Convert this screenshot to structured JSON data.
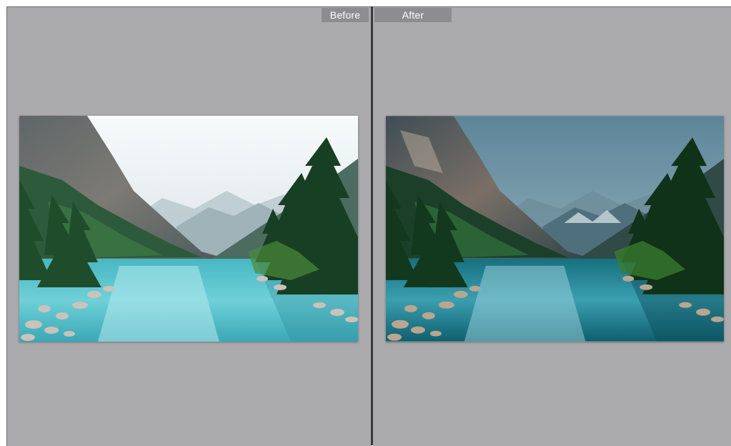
{
  "compare_view": {
    "before_label": "Before",
    "after_label": "After"
  },
  "photo": {
    "subject": "mountain-lake-landscape"
  },
  "colors": {
    "pane_background": "#ababad",
    "label_background": "#8d8d90",
    "divider": "#3a3a3c",
    "before_sky": "#f2f5f7",
    "before_water": "#5cc9d2",
    "after_sky": "#4f7b90",
    "after_water": "#1f8598"
  }
}
